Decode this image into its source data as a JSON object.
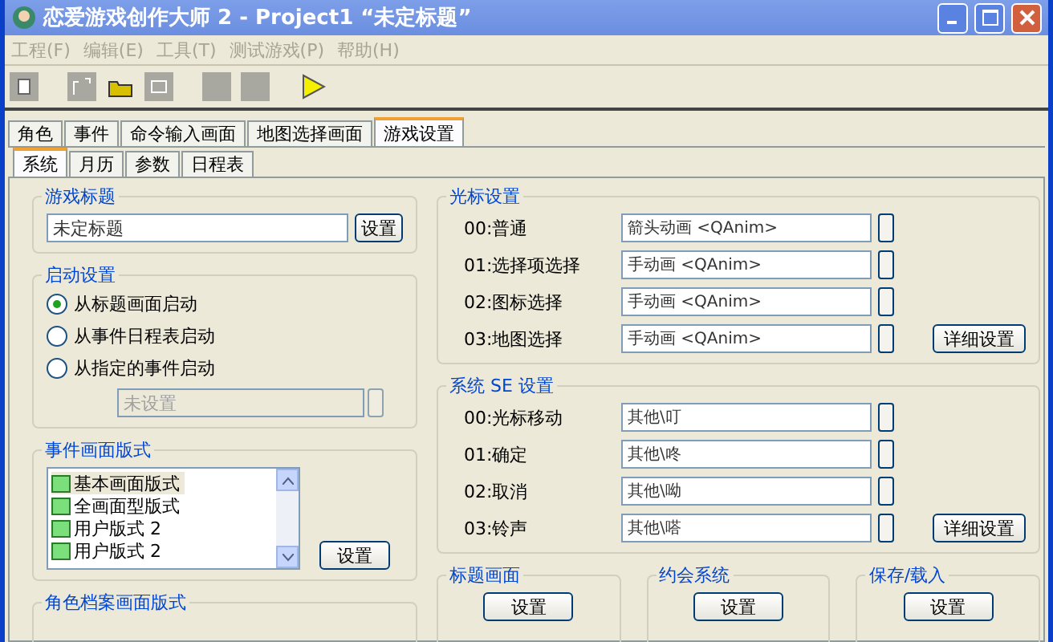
{
  "window": {
    "title": "恋爱游戏创作大师 2 - Project1 “未定标题”"
  },
  "menu": [
    {
      "label": "工程(F)",
      "disabled": true
    },
    {
      "label": "编辑(E)",
      "disabled": true
    },
    {
      "label": "工具(T)",
      "disabled": true
    },
    {
      "label": "测试游戏(P)",
      "disabled": true
    },
    {
      "label": "帮助(H)",
      "disabled": true
    }
  ],
  "toolbar": [
    {
      "kind": "page",
      "disabled": true
    },
    {
      "kind": "frame",
      "disabled": true
    },
    {
      "kind": "folder",
      "disabled": false
    },
    {
      "kind": "screen",
      "disabled": true
    },
    {
      "kind": "blank",
      "disabled": true
    },
    {
      "kind": "blank",
      "disabled": true
    },
    {
      "kind": "play",
      "disabled": false
    }
  ],
  "tabs": [
    {
      "label": "角色",
      "selected": false
    },
    {
      "label": "事件",
      "selected": false
    },
    {
      "label": "命令输入画面",
      "selected": false
    },
    {
      "label": "地图选择画面",
      "selected": false
    },
    {
      "label": "游戏设置",
      "selected": true
    }
  ],
  "subtabs": [
    {
      "label": "系统",
      "selected": true
    },
    {
      "label": "月历",
      "selected": false
    },
    {
      "label": "参数",
      "selected": false
    },
    {
      "label": "日程表",
      "selected": false
    }
  ],
  "game_title": {
    "heading": "游戏标题",
    "value": "未定标题",
    "button": "设置"
  },
  "startup": {
    "heading": "启动设置",
    "options": [
      {
        "label": "从标题画面启动",
        "selected": true
      },
      {
        "label": "从事件日程表启动",
        "selected": false
      },
      {
        "label": "从指定的事件启动",
        "selected": false
      }
    ],
    "event_field": {
      "value": "未设置",
      "disabled": true
    }
  },
  "event_layout": {
    "heading": "事件画面版式",
    "items": [
      {
        "label": "基本画面版式",
        "selected": true
      },
      {
        "label": "全画面型版式",
        "selected": false
      },
      {
        "label": "用户版式 2",
        "selected": false
      },
      {
        "label": "用户版式 2",
        "selected": false
      }
    ],
    "button": "设置"
  },
  "profile_layout": {
    "heading": "角色档案画面版式"
  },
  "cursor": {
    "heading": "光标设置",
    "rows": [
      {
        "label": "00:普通",
        "value": "箭头动画 <QAnim>"
      },
      {
        "label": "01:选择项选择",
        "value": "手动画 <QAnim>"
      },
      {
        "label": "02:图标选择",
        "value": "手动画 <QAnim>"
      },
      {
        "label": "03:地图选择",
        "value": "手动画 <QAnim>"
      }
    ],
    "button": "详细设置"
  },
  "se": {
    "heading": "系统 SE 设置",
    "rows": [
      {
        "label": "00:光标移动",
        "value": "其他\\叮"
      },
      {
        "label": "01:确定",
        "value": "其他\\咚"
      },
      {
        "label": "02:取消",
        "value": "其他\\呦"
      },
      {
        "label": "03:铃声",
        "value": "其他\\嗒"
      }
    ],
    "button": "详细设置"
  },
  "bottom_groups": [
    {
      "heading": "标题画面",
      "button": "设置"
    },
    {
      "heading": "约会系统",
      "button": "设置"
    },
    {
      "heading": "保存/载入",
      "button": "设置"
    }
  ]
}
